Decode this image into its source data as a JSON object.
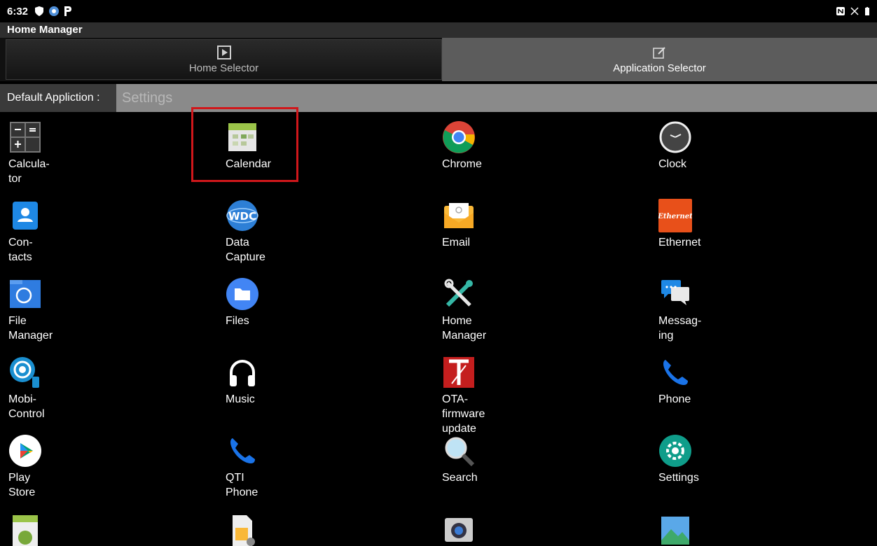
{
  "status": {
    "time": "6:32"
  },
  "appbar": {
    "title": "Home Manager"
  },
  "tabs": [
    {
      "label": "Home Selector",
      "icon": "play-box-icon"
    },
    {
      "label": "Application Selector",
      "icon": "edit-box-icon"
    }
  ],
  "default": {
    "label": "Default Appliction :",
    "value": "Settings"
  },
  "apps": [
    {
      "label": "Calcula-\ntor"
    },
    {
      "label": "Calendar"
    },
    {
      "label": "Chrome"
    },
    {
      "label": "Clock"
    },
    {
      "label": "Con-\ntacts"
    },
    {
      "label": "Data\nCapture"
    },
    {
      "label": "Email"
    },
    {
      "label": "Ethernet"
    },
    {
      "label": "File\nManager"
    },
    {
      "label": "Files"
    },
    {
      "label": "Home\nManager"
    },
    {
      "label": "Messag-\ning"
    },
    {
      "label": "Mobi-\nControl"
    },
    {
      "label": "Music"
    },
    {
      "label": "OTA-\nfirmware\nupdate"
    },
    {
      "label": "Phone"
    },
    {
      "label": "Play\nStore"
    },
    {
      "label": "QTI\nPhone"
    },
    {
      "label": "Search"
    },
    {
      "label": "Settings"
    }
  ],
  "ethernet_icon_text": "Ethernet",
  "wdc_icon_text": "WDC"
}
